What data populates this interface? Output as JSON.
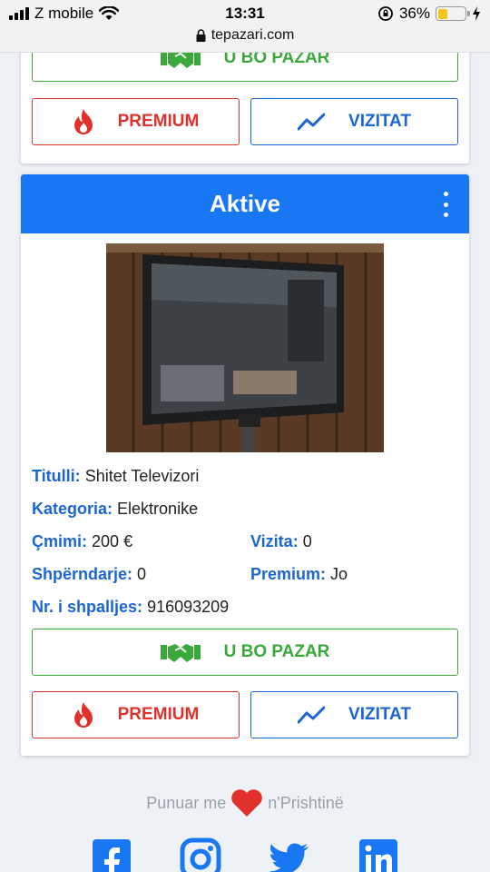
{
  "status_bar": {
    "carrier": "Z mobile",
    "time": "13:31",
    "battery_percent": "36%",
    "battery_level": 0.36,
    "url": "tepazari.com"
  },
  "top_card": {
    "deal_label": "U BO PAZAR",
    "premium_label": "PREMIUM",
    "visits_label": "VIZITAT"
  },
  "listing": {
    "status_title": "Aktive",
    "fields": {
      "title_key": "Titulli:",
      "title_val": "Shitet Televizori",
      "category_key": "Kategoria:",
      "category_val": "Elektronike",
      "price_key": "Çmimi:",
      "price_val": "200 €",
      "visits_key": "Vizita:",
      "visits_val": "0",
      "shares_key": "Shpërndarje:",
      "shares_val": "0",
      "premium_key": "Premium:",
      "premium_val": "Jo",
      "number_key": "Nr. i shpalljes:",
      "number_val": "916093209"
    },
    "deal_label": "U BO PAZAR",
    "premium_label": "PREMIUM",
    "visits_label": "VIZITAT"
  },
  "footer": {
    "made_prefix": "Punuar me",
    "made_suffix": "n'Prishtinë",
    "social": [
      "facebook-icon",
      "instagram-icon",
      "twitter-icon",
      "linkedin-icon"
    ]
  },
  "colors": {
    "primary_blue": "#1877f2",
    "green": "#3aa83a",
    "red": "#e0312a",
    "label_blue": "#1b66d2"
  }
}
